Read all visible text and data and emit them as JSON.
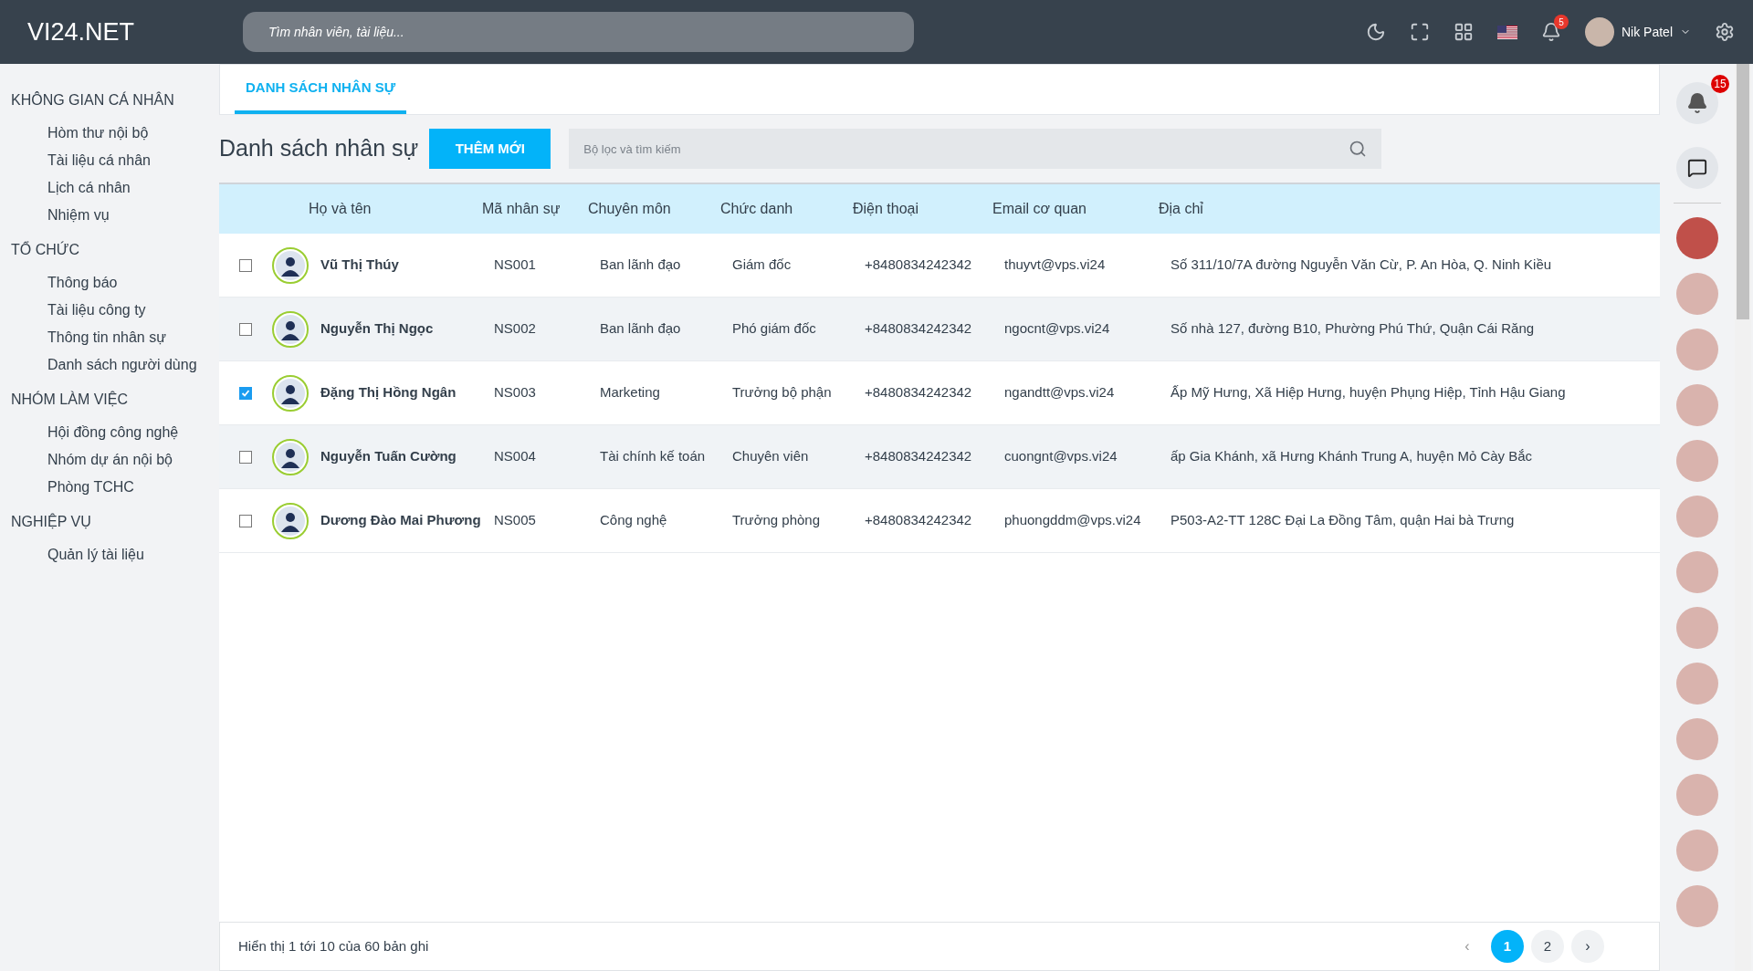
{
  "header": {
    "logo": "VI24.NET",
    "search": {
      "placeholder": "Tìm nhân viên, tài liệu..."
    },
    "notification_count": "5",
    "user": {
      "name": "Nik Patel"
    }
  },
  "sidebar": {
    "sections": [
      {
        "title": "KHÔNG GIAN CÁ NHÂN",
        "items": [
          "Hòm thư nội bộ",
          "Tài liệu cá nhân",
          "Lịch cá nhân",
          "Nhiệm vụ"
        ]
      },
      {
        "title": "TỔ CHỨC",
        "items": [
          "Thông báo",
          "Tài liệu công ty",
          "Thông tin nhân sự",
          "Danh sách người dùng"
        ]
      },
      {
        "title": "NHÓM LÀM VIỆC",
        "items": [
          "Hội đồng công nghệ",
          "Nhóm dự án nội bộ",
          "Phòng TCHC"
        ]
      },
      {
        "title": "NGHIỆP VỤ",
        "items": [
          "Quản lý tài liệu"
        ]
      }
    ]
  },
  "tabs": [
    {
      "label": "DANH SÁCH NHÂN SỰ",
      "selected": true
    }
  ],
  "page_title": "Danh sách nhân sự",
  "add_button": "THÊM MỚI",
  "filter": {
    "placeholder": "Bộ lọc và tìm kiếm"
  },
  "table": {
    "columns": [
      "Họ và tên",
      "Mã nhân sự",
      "Chuyên môn",
      "Chức danh",
      "Điện thoại",
      "Email cơ quan",
      "Địa chỉ"
    ],
    "rows": [
      {
        "checked": false,
        "cells": [
          "Vũ Thị Thúy",
          "NS001",
          "Ban lãnh đạo",
          "Giám đốc",
          "+8480834242342",
          "thuyvt@vps.vi24",
          "Số 311/10/7A đường Nguyễn Văn Cừ, P. An Hòa, Q. Ninh Kiều"
        ]
      },
      {
        "checked": false,
        "cells": [
          "Nguyễn Thị Ngọc",
          "NS002",
          "Ban lãnh đạo",
          "Phó giám đốc",
          "+8480834242342",
          "ngocnt@vps.vi24",
          "Số nhà 127, đường B10, Phường Phú Thứ, Quận Cái Răng"
        ]
      },
      {
        "checked": true,
        "cells": [
          "Đặng Thị Hồng Ngân",
          "NS003",
          "Marketing",
          "Trưởng bộ phận",
          "+8480834242342",
          "ngandtt@vps.vi24",
          "Ấp Mỹ Hưng, Xã Hiệp Hưng, huyện Phụng Hiệp, Tỉnh Hậu Giang"
        ]
      },
      {
        "checked": false,
        "cells": [
          "Nguyễn Tuấn Cường",
          "NS004",
          "Tài chính kế toán",
          "Chuyên viên",
          "+8480834242342",
          "cuongnt@vps.vi24",
          "ấp Gia Khánh, xã Hưng Khánh Trung A, huyện Mỏ Cày Bắc"
        ]
      },
      {
        "checked": false,
        "cells": [
          "Dương Đào Mai Phương",
          "NS005",
          "Công nghệ",
          "Trưởng phòng",
          "+8480834242342",
          "phuongddm@vps.vi24",
          "P503-A2-TT 128C Đại La Đồng Tâm, quận Hai bà Trưng"
        ]
      }
    ]
  },
  "footer": {
    "summary": "Hiển thị 1 tới 10 của 60 bản ghi",
    "prev": "‹",
    "pages": [
      {
        "label": "1",
        "selected": true
      },
      {
        "label": "2",
        "selected": false
      }
    ],
    "next": "›"
  },
  "right_rail": {
    "notification_count": "15",
    "contacts": [
      {
        "online": true
      },
      {
        "online": false
      },
      {
        "online": false
      },
      {
        "online": false
      },
      {
        "online": false
      },
      {
        "online": false
      },
      {
        "online": false
      },
      {
        "online": false
      },
      {
        "online": false
      },
      {
        "online": false
      },
      {
        "online": false
      },
      {
        "online": false
      },
      {
        "online": false
      }
    ]
  }
}
